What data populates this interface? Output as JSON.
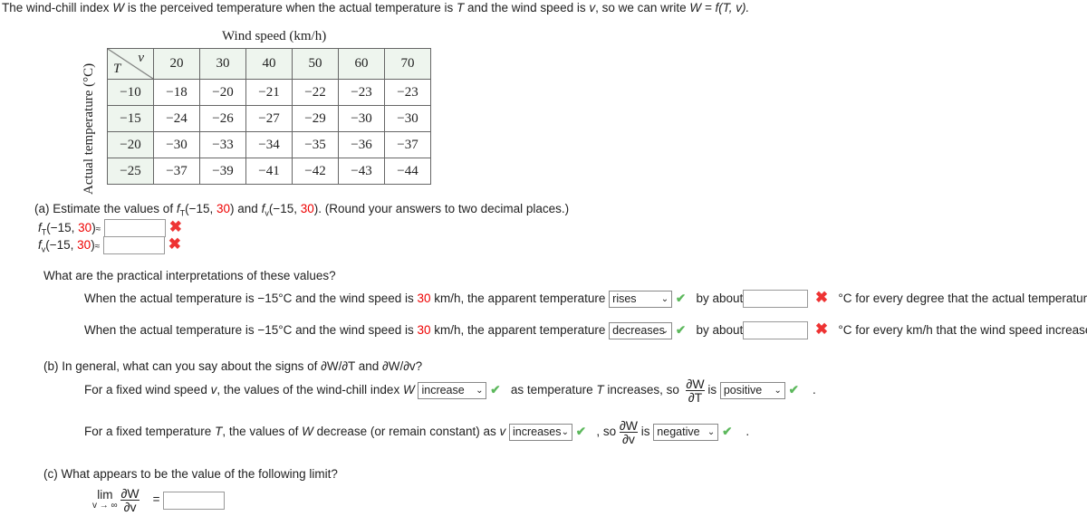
{
  "intro": {
    "a": "The wind-chill index ",
    "W": "W",
    "b": " is the perceived temperature when the actual temperature is ",
    "T": "T",
    "c": " and the wind speed is ",
    "v": "v",
    "d": ", so we can write  ",
    "eq": "W = f(T, v)."
  },
  "table": {
    "title": "Wind speed (km/h)",
    "row_axis_label": "Actual temperature (°C)",
    "corner_v": "v",
    "corner_T": "T",
    "speeds": [
      "20",
      "30",
      "40",
      "50",
      "60",
      "70"
    ],
    "rows": [
      {
        "T": "−10",
        "values": [
          "−18",
          "−20",
          "−21",
          "−22",
          "−23",
          "−23"
        ]
      },
      {
        "T": "−15",
        "values": [
          "−24",
          "−26",
          "−27",
          "−29",
          "−30",
          "−30"
        ]
      },
      {
        "T": "−20",
        "values": [
          "−30",
          "−33",
          "−34",
          "−35",
          "−36",
          "−37"
        ]
      },
      {
        "T": "−25",
        "values": [
          "−37",
          "−39",
          "−41",
          "−42",
          "−43",
          "−44"
        ]
      }
    ]
  },
  "part_a": {
    "prompt_a": "(a) Estimate the values of ",
    "fT": "f",
    "sub_T": "T",
    "args_a": "(−15, ",
    "red30": "30",
    "close": ")",
    "and": " and ",
    "sub_v": "v",
    "tail": ". (Round your answers to two decimal places.)",
    "approx": "≈",
    "fT_value": "",
    "fv_value": "",
    "fT_status": "incorrect",
    "fv_status": "incorrect"
  },
  "interp": {
    "question": "What are the practical interpretations of these values?",
    "line_pre": "When the actual temperature is −15°C and the wind speed is ",
    "red30": "30",
    "line_mid": " km/h, the apparent temperature",
    "sel1": "rises",
    "sel2": "decreases",
    "by_about": "by about",
    "by1_value": "",
    "by2_value": "",
    "tail1": "°C for every degree that the actual temperature rises.",
    "tail2": "°C for every km/h that the wind speed increases."
  },
  "part_b": {
    "prompt": "(b) In general, what can you say about the signs of  ∂W/∂T and ∂W/∂v?",
    "l1_a": "For a fixed wind speed ",
    "l1_v": "v",
    ", ": "",
    "l1_b": ", the values of the wind-chill index ",
    "l1_W": "W",
    "sel_a": "increase",
    "l1_c": "as temperature ",
    "l1_T": "T",
    "l1_d": " increases, so",
    "dW": "∂W",
    "dT": "∂T",
    "is": "is",
    "sel_b": "positive",
    "l2_a": "For a fixed temperature ",
    "l2_T": "T",
    "l2_b": ", the values of ",
    "l2_W": "W",
    "l2_c": " decrease (or remain constant) as ",
    "l2_v": "v",
    "sel_c": "increases",
    "so": ", so",
    "dv": "∂v",
    "sel_d": "negative",
    "period": "."
  },
  "part_c": {
    "prompt": "(c) What appears to be the value of the following limit?",
    "lim": "lim",
    "sub": "v → ∞",
    "dW": "∂W",
    "dv": "∂v",
    "eq": "=",
    "value": ""
  },
  "icons": {
    "correct": "✔",
    "incorrect": "✖"
  }
}
